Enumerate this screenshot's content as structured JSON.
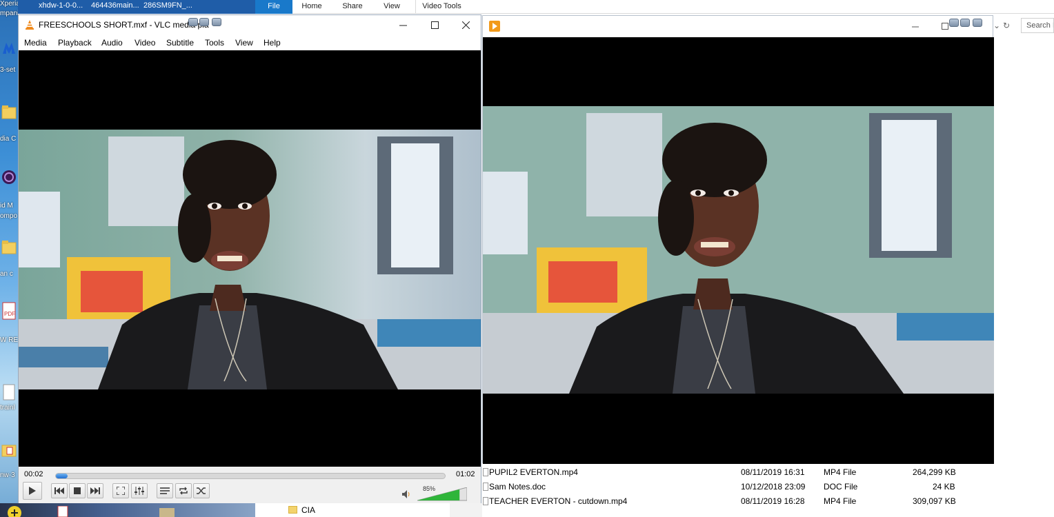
{
  "desktop": {
    "labels": [
      "Xperia",
      "mpanion",
      "3-set",
      "dia C",
      "id M",
      "ompo",
      "an c",
      "W RE",
      "trainl",
      "nw-3"
    ],
    "top_strip_items": [
      "xhdw-1-0-0...",
      "464436main...",
      "286SM9FN_..."
    ]
  },
  "ribbon": {
    "tabs": [
      "File",
      "Home",
      "Share",
      "View",
      "Video Tools"
    ]
  },
  "vlc": {
    "title": "FREESCHOOLS SHORT.mxf - VLC media pla",
    "menu": [
      "Media",
      "Playback",
      "Audio",
      "Video",
      "Subtitle",
      "Tools",
      "View",
      "Help"
    ],
    "time_elapsed": "00:02",
    "time_total": "01:02",
    "progress_fraction": 0.03,
    "volume_label": "85%",
    "volume_fraction": 0.85,
    "accent": "#1f6fd1"
  },
  "explorer": {
    "search_placeholder": "Search I",
    "files": [
      {
        "name": "PUPIL2 EVERTON.mp4",
        "date": "08/11/2019 16:31",
        "type": "MP4 File",
        "size": "264,299 KB"
      },
      {
        "name": "Sam Notes.doc",
        "date": "10/12/2018 23:09",
        "type": "DOC File",
        "size": "24 KB"
      },
      {
        "name": "TEACHER EVERTON - cutdown.mp4",
        "date": "08/11/2019 16:28",
        "type": "MP4 File",
        "size": "309,097 KB"
      }
    ],
    "folder_label": "CIA"
  }
}
